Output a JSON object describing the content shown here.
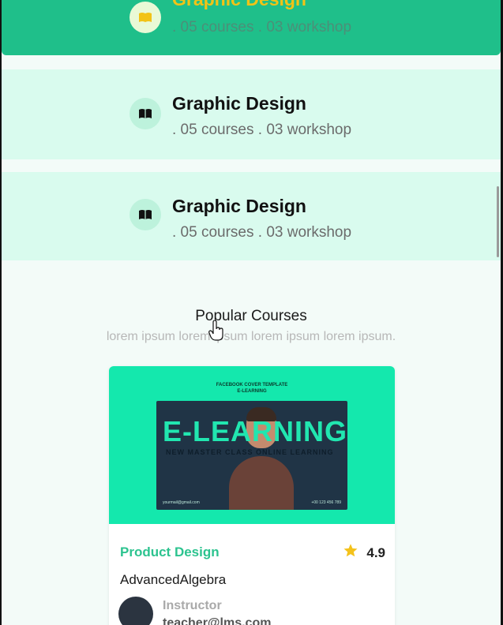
{
  "categories": [
    {
      "title": "Graphic Design",
      "meta": ". 05 courses . 03 workshop",
      "icon": "book-icon",
      "active": true
    },
    {
      "title": "Graphic Design",
      "meta": ". 05 courses . 03 workshop",
      "icon": "book-icon",
      "active": false
    },
    {
      "title": "Graphic Design",
      "meta": ". 05 courses . 03 workshop",
      "icon": "book-icon",
      "active": false
    }
  ],
  "popular": {
    "title": "Popular Courses",
    "subtitle": "lorem ipsum lorem ipsum lorem ipsum lorem ipsum."
  },
  "course_card": {
    "thumbnail": {
      "top_text_1": "FACEBOOK COVER TEMPLATE",
      "top_text_2": "E-LEARNING",
      "banner_title": "E-LEARNING",
      "banner_sub": "NEW MASTER CLASS ONLINE LEARNING",
      "footer_left": "yourmail@gmail.com",
      "footer_right": "+00 123 456 789"
    },
    "category": "Product Design",
    "rating": "4.9",
    "name": "AdvancedAlgebra",
    "instructor_label": "Instructor",
    "instructor_email": "teacher@lms.com"
  },
  "colors": {
    "active_bg": "#1fbf8a",
    "accent_green": "#2cc38f",
    "card_thumb": "#14e8ad",
    "star": "#f4c21b"
  }
}
